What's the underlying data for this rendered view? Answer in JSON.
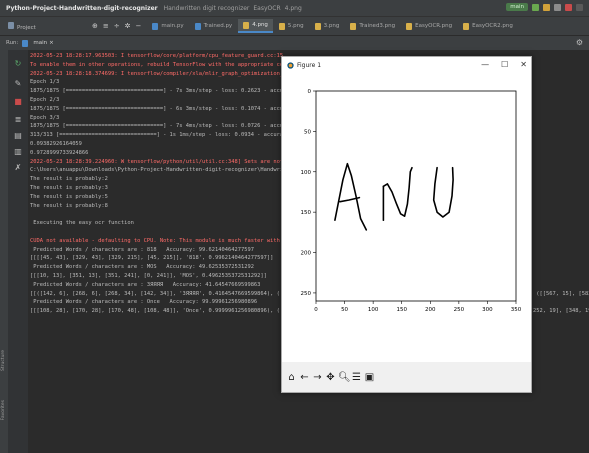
{
  "titlebar": {
    "project": "Python-Project-Handwritten-digit-recognizer",
    "crumbs": [
      "Handwritten digit recognizer",
      "EasyOCR",
      "4.png"
    ],
    "branch": "main"
  },
  "toolbar": {
    "project_selector": "Project",
    "tabs": [
      "main.py",
      "Trained.py",
      "4.png",
      "5.png",
      "3.png",
      "Trained3.png",
      "EasyOCR.png",
      "EasyOCR2.png"
    ],
    "active_tab_index": 2
  },
  "runbar": {
    "label": "Run:",
    "config": "main"
  },
  "sidestrip": {
    "structure": "Structure",
    "favorites": "Favorites"
  },
  "console": {
    "lines": [
      {
        "cls": "err",
        "text": "2022-05-23 18:28:17.963503: I tensorflow/core/platform/cpu_feature_guard.cc:15"
      },
      {
        "cls": "err",
        "text": "To enable them in other operations, rebuild TensorFlow with the appropriate com"
      },
      {
        "cls": "err",
        "text": "2022-05-23 18:28:18.374699: I tensorflow/compiler/xla/mlir_graph_optimization_"
      },
      {
        "cls": "out",
        "text": "Epoch 1/3"
      },
      {
        "cls": "out",
        "text": "1875/1875 [==============================] - 7s 3ms/step - loss: 0.2623 - accura"
      },
      {
        "cls": "out",
        "text": "Epoch 2/3"
      },
      {
        "cls": "out",
        "text": "1875/1875 [==============================] - 6s 3ms/step - loss: 0.1074 - accura"
      },
      {
        "cls": "out",
        "text": "Epoch 3/3"
      },
      {
        "cls": "out",
        "text": "1875/1875 [==============================] - 7s 4ms/step - loss: 0.0726 - accura"
      },
      {
        "cls": "out",
        "text": "313/313 [==============================] - 1s 1ms/step - loss: 0.0934 - accurac"
      },
      {
        "cls": "out",
        "text": "0.09382926164059"
      },
      {
        "cls": "out",
        "text": "0.9728999733924866"
      },
      {
        "cls": "err",
        "text": "2022-05-23 18:28:39.224960: W tensorflow/python/util/util.cc:348] Sets are not"
      },
      {
        "cls": "out",
        "text": "C:\\Users\\anuappu\\Downloads\\Python-Project-Handwritten-digit-recognizer\\Handwrit"
      },
      {
        "cls": "out",
        "text": "The result is probably:2"
      },
      {
        "cls": "out",
        "text": "The result is probably:3"
      },
      {
        "cls": "out",
        "text": "The result is probably:5"
      },
      {
        "cls": "out",
        "text": "The result is probably:8"
      },
      {
        "cls": "out",
        "text": ""
      },
      {
        "cls": "out",
        "text": " Executing the easy ocr function"
      },
      {
        "cls": "out",
        "text": ""
      },
      {
        "cls": "err",
        "text": "CUDA not available - defaulting to CPU. Note: This module is much faster with a"
      },
      {
        "cls": "out",
        "text": " Predicted Words / characters are : 818   Accuracy: 99.62140464277597"
      },
      {
        "cls": "out",
        "text": "[[[[45, 43], [329, 43], [329, 215], [45, 215]], '818', 0.9962140464277597]]"
      },
      {
        "cls": "out",
        "text": " Predicted Words / characters are : MOS   Accuracy: 49.62535372531292"
      },
      {
        "cls": "out",
        "text": "[[[10, 13], [351, 13], [351, 241], [0, 241]], 'MOS', 0.4962535372531292]]"
      },
      {
        "cls": "out",
        "text": " Predicted Words / characters are : 3ЯЯЯЯ   Accuracy: 41.64547669599863"
      },
      {
        "cls": "out",
        "text": "[[([142, 6], [268, 6], [268, 34], [142, 34]], '3ЯЯЯЯ', 0.4164547669599864), ([[289, 0], [551, 0], [551, 48], [289, 48]], '4ЯЯЯ ЯЯЯЯЯ', 0.4155558327203484), ([[567, 15], [582, 15"
      },
      {
        "cls": "out",
        "text": " Predicted Words / characters are : Once   Accuracy: 99.99961256980896"
      },
      {
        "cls": "out",
        "text": "[[[108, 28], [170, 28], [170, 48], [108, 48]], 'Once', 0.9999961256980896), ([[202, 26], [244, 26], [244, 54], [202, 54]], 'upon', 0.6820315941025249), ([[252, 19], [348, 19], [3"
      }
    ]
  },
  "figure": {
    "title": "Figure 1",
    "minimize": "—",
    "maximize": "☐",
    "close": "✕",
    "handwriting": "ANU",
    "toolbar_icons": [
      "home-icon",
      "back-icon",
      "forward-icon",
      "pan-icon",
      "zoom-icon",
      "configure-icon",
      "save-icon"
    ]
  },
  "chart_data": {
    "type": "image",
    "xlim": [
      0,
      350
    ],
    "ylim": [
      260,
      0
    ],
    "xticks": [
      0,
      50,
      100,
      150,
      200,
      250,
      300,
      350
    ],
    "yticks": [
      0,
      50,
      100,
      150,
      200,
      250
    ],
    "strokes": [
      [
        [
          33,
          160
        ],
        [
          40,
          135
        ],
        [
          47,
          110
        ],
        [
          55,
          90
        ],
        [
          62,
          105
        ],
        [
          70,
          130
        ],
        [
          78,
          158
        ],
        [
          88,
          172
        ]
      ],
      [
        [
          42,
          137
        ],
        [
          58,
          135
        ],
        [
          76,
          132
        ]
      ],
      [
        [
          118,
          160
        ],
        [
          118,
          140
        ],
        [
          118,
          118
        ]
      ],
      [
        [
          118,
          118
        ],
        [
          125,
          115
        ],
        [
          133,
          125
        ],
        [
          141,
          140
        ],
        [
          148,
          152
        ],
        [
          155,
          155
        ],
        [
          160,
          140
        ],
        [
          163,
          120
        ],
        [
          165,
          100
        ],
        [
          168,
          95
        ]
      ],
      [
        [
          212,
          95
        ],
        [
          208,
          115
        ],
        [
          206,
          135
        ],
        [
          212,
          150
        ],
        [
          222,
          156
        ],
        [
          233,
          150
        ],
        [
          238,
          130
        ],
        [
          240,
          110
        ],
        [
          239,
          95
        ]
      ]
    ],
    "colors": {
      "ink": "#000000"
    }
  }
}
